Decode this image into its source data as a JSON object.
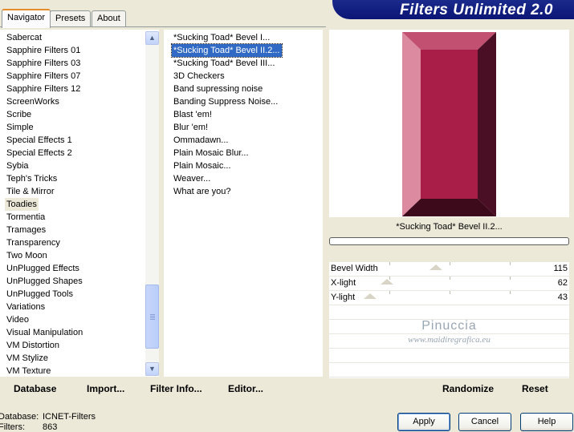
{
  "tabs": [
    {
      "label": "Navigator",
      "active": true
    },
    {
      "label": "Presets",
      "active": false
    },
    {
      "label": "About",
      "active": false
    }
  ],
  "banner": {
    "title": "Filters Unlimited 2.0"
  },
  "categories": [
    "Sabercat",
    "Sapphire Filters 01",
    "Sapphire Filters 03",
    "Sapphire Filters 07",
    "Sapphire Filters 12",
    "ScreenWorks",
    "Scribe",
    "Simple",
    "Special Effects 1",
    "Special Effects 2",
    "Sybia",
    "Teph's Tricks",
    "Tile & Mirror",
    "Toadies",
    "Tormentia",
    "Tramages",
    "Transparency",
    "Two Moon",
    "UnPlugged Effects",
    "UnPlugged Shapes",
    "UnPlugged Tools",
    "Variations",
    "Video",
    "Visual Manipulation",
    "VM Distortion",
    "VM Stylize",
    "VM Texture"
  ],
  "selected_category": "Toadies",
  "filters": [
    "*Sucking Toad*  Bevel I...",
    "*Sucking Toad*  Bevel II.2...",
    "*Sucking Toad*  Bevel III...",
    "3D Checkers",
    "Band supressing noise",
    "Banding Suppress Noise...",
    "Blast 'em!",
    "Blur 'em!",
    "Ommadawn...",
    "Plain Mosaic Blur...",
    "Plain Mosaic...",
    "Weaver...",
    "What are you?"
  ],
  "selected_filter": "*Sucking Toad*  Bevel II.2...",
  "current_filter_name": "*Sucking Toad*  Bevel II.2...",
  "parameters": [
    {
      "label": "Bevel Width",
      "value": "115",
      "level": 0.45
    },
    {
      "label": "X-light",
      "value": "62",
      "level": 0.24
    },
    {
      "label": "Y-light",
      "value": "43",
      "level": 0.17
    }
  ],
  "watermark": {
    "line1": "Pinuccia",
    "line2": "www.maidiregrafica.eu"
  },
  "bottom_buttons": {
    "database": "Database",
    "import": "Import...",
    "filter_info": "Filter Info...",
    "editor": "Editor...",
    "randomize": "Randomize",
    "reset": "Reset"
  },
  "info": {
    "database_label": "Database:",
    "database_value": "ICNET-Filters",
    "filters_label": "Filters:",
    "filters_value": "863"
  },
  "dialog_buttons": {
    "apply": "Apply",
    "cancel": "Cancel",
    "help": "Help"
  },
  "colors": {
    "bevel_face": "#a91e48",
    "bevel_light": "#dc8aa0",
    "bevel_top": "#c15071",
    "bevel_dark": "#3d0a1c",
    "selection": "#316ac5",
    "banner": "#0b1575"
  }
}
